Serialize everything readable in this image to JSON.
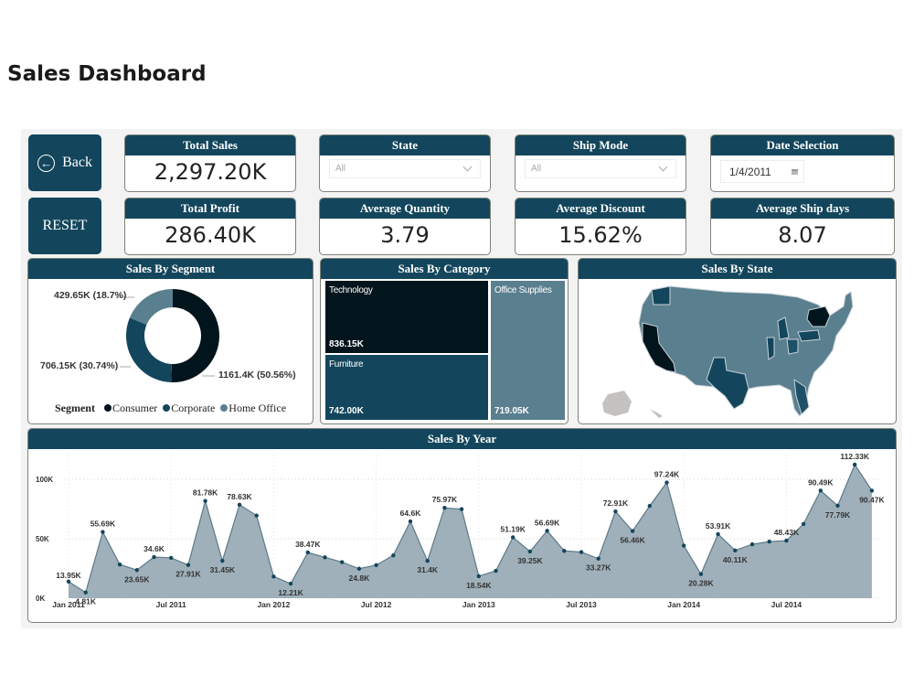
{
  "page": {
    "title": "Sales Dashboard"
  },
  "nav": {
    "back_label": "Back",
    "reset_label": "RESET"
  },
  "kpis": {
    "total_sales": {
      "label": "Total Sales",
      "value": "2,297.20K"
    },
    "total_profit": {
      "label": "Total Profit",
      "value": "286.40K"
    },
    "avg_quantity": {
      "label": "Average Quantity",
      "value": "3.79"
    },
    "avg_discount": {
      "label": "Average Discount",
      "value": "15.62%"
    },
    "avg_ship_days": {
      "label": "Average Ship days",
      "value": "8.07"
    }
  },
  "slicers": {
    "state": {
      "label": "State",
      "value": "All"
    },
    "ship_mode": {
      "label": "Ship Mode",
      "value": "All"
    },
    "date": {
      "label": "Date Selection",
      "value": "1/4/2011"
    }
  },
  "colors": {
    "primary": "#13465c",
    "dark": "#02141c",
    "light": "#5a7f8f",
    "area": "#9fb0ba"
  },
  "segment": {
    "title": "Sales By Segment",
    "legend_title": "Segment",
    "slices": [
      {
        "name": "Consumer",
        "value": 1161.4,
        "label": "1161.4K (50.56%)",
        "color": "#02141c"
      },
      {
        "name": "Corporate",
        "value": 706.15,
        "label": "706.15K (30.74%)",
        "color": "#13465c"
      },
      {
        "name": "Home Office",
        "value": 429.65,
        "label": "429.65K (18.7%)",
        "color": "#5a7f8f"
      }
    ]
  },
  "category": {
    "title": "Sales By Category",
    "items": [
      {
        "name": "Technology",
        "value": "836.15K",
        "color": "#02141c"
      },
      {
        "name": "Furniture",
        "value": "742.00K",
        "color": "#13465c"
      },
      {
        "name": "Office Supplies",
        "value": "719.05K",
        "color": "#5a7f8f"
      }
    ]
  },
  "state_map": {
    "title": "Sales By State"
  },
  "chart_data": {
    "type": "area",
    "title": "Sales By Year",
    "xlabel": "",
    "ylabel": "",
    "ylim": [
      0,
      120
    ],
    "y_ticks": [
      "0K",
      "50K",
      "100K"
    ],
    "y_tick_values": [
      0,
      50,
      100
    ],
    "x_ticks": [
      "Jan 2011",
      "Jul 2011",
      "Jan 2012",
      "Jul 2012",
      "Jan 2013",
      "Jul 2013",
      "Jan 2014",
      "Jul 2014"
    ],
    "x_tick_index": [
      0,
      6,
      12,
      18,
      24,
      30,
      36,
      42
    ],
    "unit": "K",
    "values": [
      13.95,
      4.81,
      55.69,
      28.3,
      23.65,
      34.6,
      33.9,
      27.91,
      81.78,
      31.45,
      78.63,
      69.5,
      18.2,
      12.21,
      38.47,
      34.4,
      30.3,
      24.8,
      27.8,
      36.0,
      64.6,
      31.4,
      75.97,
      74.9,
      18.54,
      23.0,
      51.19,
      39.25,
      56.69,
      39.8,
      38.8,
      33.27,
      72.91,
      56.46,
      77.6,
      97.24,
      44.2,
      20.28,
      53.91,
      40.11,
      45.3,
      47.6,
      48.43,
      62.4,
      90.49,
      77.79,
      112.33,
      90.47
    ],
    "labels": {
      "0": "13.95K",
      "1": "4.81K",
      "2": "55.69K",
      "4": "23.65K",
      "5": "34.6K",
      "7": "27.91K",
      "8": "81.78K",
      "9": "31.45K",
      "10": "78.63K",
      "13": "12.21K",
      "14": "38.47K",
      "17": "24.8K",
      "20": "64.6K",
      "21": "31.4K",
      "22": "75.97K",
      "24": "18.54K",
      "26": "51.19K",
      "27": "39.25K",
      "28": "56.69K",
      "31": "33.27K",
      "32": "72.91K",
      "33": "56.46K",
      "35": "97.24K",
      "37": "20.28K",
      "38": "53.91K",
      "39": "40.11K",
      "42": "48.43K",
      "44": "90.49K",
      "45": "77.79K",
      "46": "112.33K",
      "47": "90.47K"
    },
    "grid": true,
    "legend": "none"
  }
}
